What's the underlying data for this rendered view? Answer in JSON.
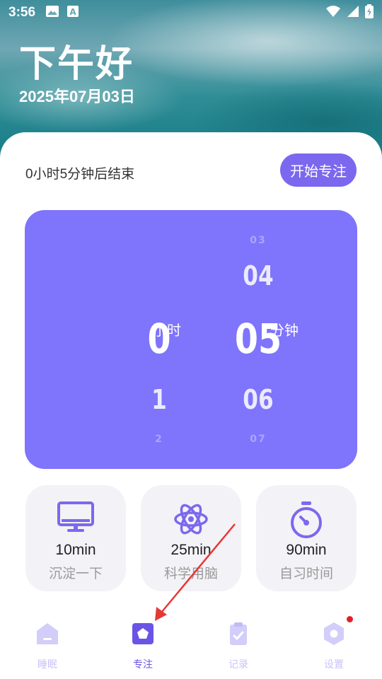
{
  "status_bar": {
    "time": "3:56",
    "left_icons": [
      "image-icon",
      "font-a-icon"
    ],
    "right_icons": [
      "wifi-icon",
      "signal-icon",
      "battery-charging-icon"
    ]
  },
  "header": {
    "greeting": "下午好",
    "date": "2025年07月03日"
  },
  "focus": {
    "remaining_text": "0小时5分钟后结束",
    "start_button_label": "开始专注"
  },
  "picker": {
    "hour": {
      "values": [
        "0",
        "1",
        "2"
      ],
      "selected": "0",
      "unit": "小时"
    },
    "minute": {
      "values": [
        "03",
        "04",
        "05",
        "06",
        "07"
      ],
      "selected": "05",
      "unit": "分钟"
    }
  },
  "presets": [
    {
      "icon": "monitor-icon",
      "time": "10min",
      "label": "沉淀一下"
    },
    {
      "icon": "atom-icon",
      "time": "25min",
      "label": "科学用脑"
    },
    {
      "icon": "stopwatch-icon",
      "time": "90min",
      "label": "自习时间"
    }
  ],
  "tabbar": {
    "items": [
      {
        "icon": "home-icon",
        "label": "睡眠",
        "active": false
      },
      {
        "icon": "focus-icon",
        "label": "专注",
        "active": true
      },
      {
        "icon": "clipboard-icon",
        "label": "记录",
        "active": false
      },
      {
        "icon": "settings-icon",
        "label": "设置",
        "active": false,
        "badge": true
      }
    ]
  },
  "colors": {
    "accent": "#7b68ee",
    "picker_bg": "#7f74fc",
    "tab_active": "#6a54e6",
    "tab_inactive": "#c9c3f7",
    "annotation_arrow": "#e53935",
    "badge": "#e0202a"
  }
}
